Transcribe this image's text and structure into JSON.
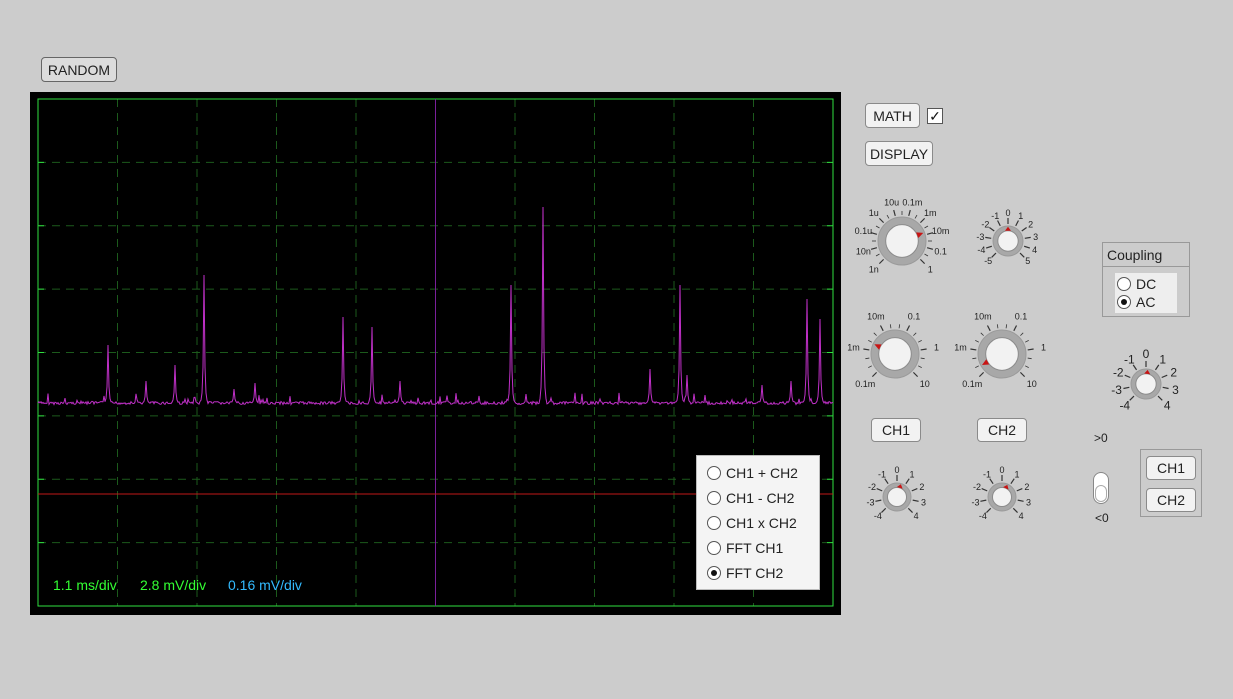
{
  "random_label": "RANDOM",
  "math_label": "MATH",
  "math_checked": true,
  "display_label": "DISPLAY",
  "readouts": {
    "time_div": "1.1 ms/div",
    "ch1_div": "2.8 mV/div",
    "ch2_div": "0.16 mV/div"
  },
  "math_options": [
    "CH1 + CH2",
    "CH1 - CH2",
    "CH1 x CH2",
    "FFT CH1",
    "FFT CH2"
  ],
  "math_selected": "FFT CH2",
  "colors": {
    "trace": "#c030c8",
    "grid": "#2fe03f",
    "ch1_readout": "#33ff33",
    "ch2_readout": "#33bbff",
    "ref_line": "#c01818",
    "cursor_line": "#7a1f9a"
  },
  "channel_buttons": {
    "ch1": "CH1",
    "ch2": "CH2"
  },
  "coupling": {
    "title": "Coupling",
    "options": [
      "DC",
      "AC"
    ],
    "selected": "AC"
  },
  "trigger": {
    "above_label": ">0",
    "below_label": "<0",
    "source_ch1": "CH1",
    "source_ch2": "CH2"
  },
  "knobs": {
    "timebase": {
      "labels": [
        "1n",
        "10n",
        "0.1u",
        "1u",
        "10u",
        "0.1m",
        "1m",
        "10m",
        "0.1",
        "1"
      ]
    },
    "position": {
      "labels": [
        "-5",
        "-4",
        "-3",
        "-2",
        "-1",
        "0",
        "1",
        "2",
        "3",
        "4",
        "5"
      ]
    },
    "ch1_volts": {
      "labels": [
        "0.1m",
        "1m",
        "10m",
        "0.1",
        "1",
        "10"
      ]
    },
    "ch2_volts": {
      "labels": [
        "0.1m",
        "1m",
        "10m",
        "0.1",
        "1",
        "10"
      ]
    },
    "ch1_offset": {
      "labels": [
        "-4",
        "-3",
        "-2",
        "-1",
        "0",
        "1",
        "2",
        "3",
        "4"
      ]
    },
    "ch2_offset": {
      "labels": [
        "-4",
        "-3",
        "-2",
        "-1",
        "0",
        "1",
        "2",
        "3",
        "4"
      ]
    },
    "trigger_level": {
      "labels": [
        "-4",
        "-3",
        "-2",
        "-1",
        "0",
        "1",
        "2",
        "3",
        "4"
      ]
    }
  }
}
